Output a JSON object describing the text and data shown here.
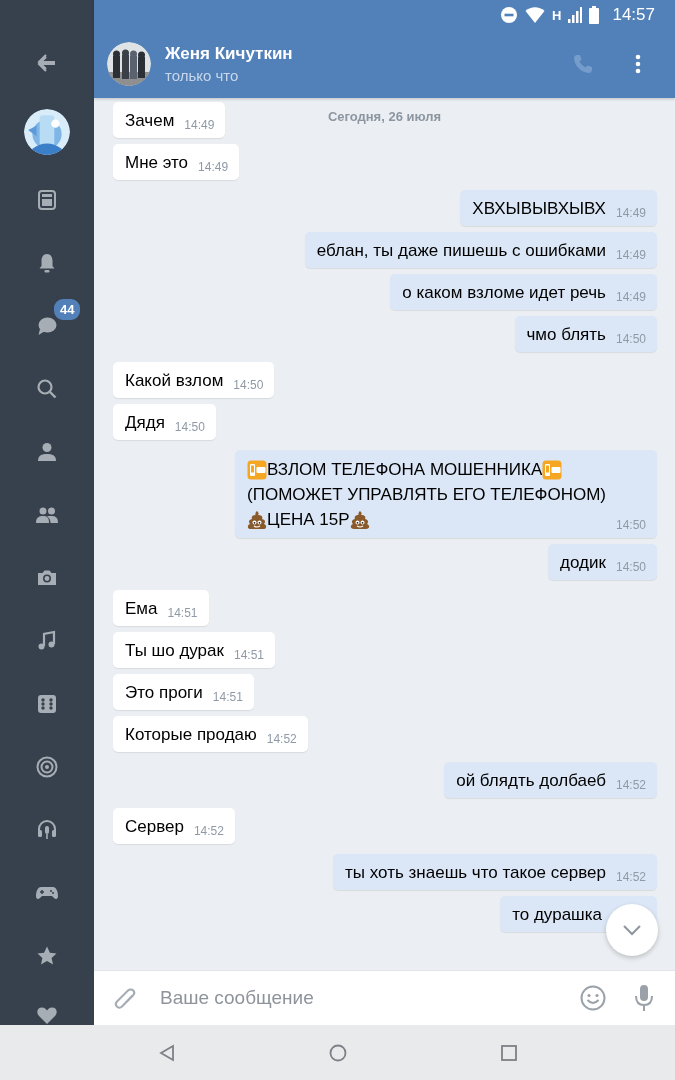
{
  "status_bar": {
    "network": "H",
    "time": "14:57"
  },
  "sidebar": {
    "items": [
      {
        "kind": "back"
      },
      {
        "kind": "avatar"
      },
      {
        "kind": "news"
      },
      {
        "kind": "bell"
      },
      {
        "kind": "messages",
        "badge": "44"
      },
      {
        "kind": "search"
      },
      {
        "kind": "person"
      },
      {
        "kind": "people"
      },
      {
        "kind": "camera"
      },
      {
        "kind": "music"
      },
      {
        "kind": "dice"
      },
      {
        "kind": "target"
      },
      {
        "kind": "podcast"
      },
      {
        "kind": "gamepad"
      },
      {
        "kind": "star"
      },
      {
        "kind": "heart"
      }
    ]
  },
  "header": {
    "name": "Женя Кичуткин",
    "status": "только что"
  },
  "chat": {
    "date": "Сегодня, 26 июля",
    "messages": [
      {
        "kind": "incoming",
        "text": "Зачем",
        "time": "14:49"
      },
      {
        "kind": "incoming",
        "text": "Мне это",
        "time": "14:49"
      },
      {
        "kind": "outgoing",
        "text": "ХВХЫВЫВХЫВХ",
        "time": "14:49"
      },
      {
        "kind": "outgoing",
        "text": "еблан, ты даже пишешь с ошибками",
        "time": "14:49"
      },
      {
        "kind": "outgoing",
        "text": "о каком взломе идет речь",
        "time": "14:49"
      },
      {
        "kind": "outgoing",
        "text": "чмо блять",
        "time": "14:50"
      },
      {
        "kind": "incoming",
        "text": "Какой взлом",
        "time": "14:50"
      },
      {
        "kind": "incoming",
        "text": "Дядя",
        "time": "14:50"
      },
      {
        "kind": "outgoing",
        "parts": [
          {
            "kind": "phoneoff"
          },
          {
            "kind": "text",
            "text": "ВЗЛОМ ТЕЛЕФОНА МОШЕННИКА"
          },
          {
            "kind": "phoneoff"
          },
          {
            "kind": "break"
          },
          {
            "kind": "text",
            "text": "(ПОМОЖЕТ УПРАВЛЯТЬ ЕГО ТЕЛЕФОНОМ)"
          },
          {
            "kind": "break"
          },
          {
            "kind": "poop"
          },
          {
            "kind": "text",
            "text": "ЦЕНА 15Р"
          },
          {
            "kind": "poop"
          }
        ],
        "time": "14:50"
      },
      {
        "kind": "outgoing",
        "text": "додик",
        "time": "14:50"
      },
      {
        "kind": "incoming",
        "text": "Ема",
        "time": "14:51"
      },
      {
        "kind": "incoming",
        "text": "Ты шо дурак",
        "time": "14:51"
      },
      {
        "kind": "incoming",
        "text": "Это проги",
        "time": "14:51"
      },
      {
        "kind": "incoming",
        "text": "Которые продаю",
        "time": "14:52"
      },
      {
        "kind": "outgoing",
        "text": "ой блядть долбаеб",
        "time": "14:52"
      },
      {
        "kind": "incoming",
        "text": "Сервер",
        "time": "14:52"
      },
      {
        "kind": "outgoing",
        "text": "ты хоть знаешь что такое сервер",
        "time": "14:52"
      },
      {
        "kind": "outgoing",
        "text": "то дурашка"
      }
    ]
  },
  "composer": {
    "placeholder": "Ваше сообщение"
  }
}
